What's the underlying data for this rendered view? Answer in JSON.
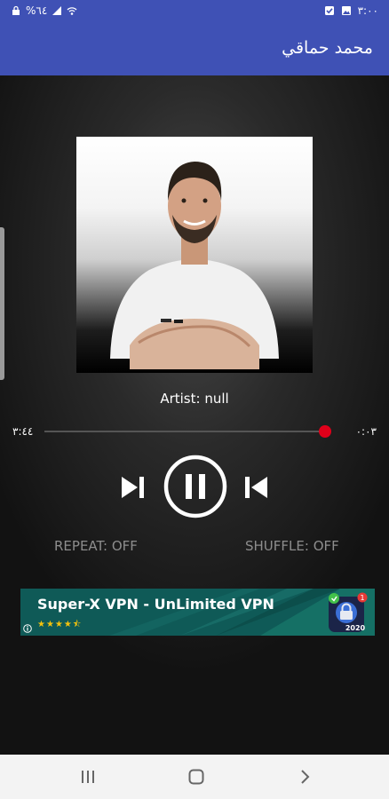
{
  "status_bar": {
    "time": "٣:٠٠",
    "battery": "%٦٤",
    "icons": [
      "lock-icon",
      "wifi-icon",
      "signal-icon",
      "image-icon",
      "check-icon"
    ]
  },
  "app_bar": {
    "title": "محمد حماقي"
  },
  "player": {
    "artist_label": "Artist: null",
    "time_elapsed": "٠:٠٣",
    "time_total": "٣:٤٤",
    "progress_fraction": 0.01,
    "controls": [
      "next-icon",
      "pause-icon",
      "previous-icon"
    ],
    "repeat_label": "REPEAT: OFF",
    "shuffle_label": "SHUFFLE: OFF"
  },
  "ad": {
    "title": "Super-X VPN - UnLimited VPN",
    "stars": "★★★★⯪",
    "badge_count": "1",
    "year": "2020"
  },
  "nav_bar": {
    "buttons": [
      "recents-icon",
      "home-icon",
      "back-icon"
    ]
  },
  "colors": {
    "app_bar": "#3f51b5",
    "seek_thumb": "#e0001a",
    "ad_bg": "#0f5a57",
    "muted_text": "#8d8d8d"
  }
}
